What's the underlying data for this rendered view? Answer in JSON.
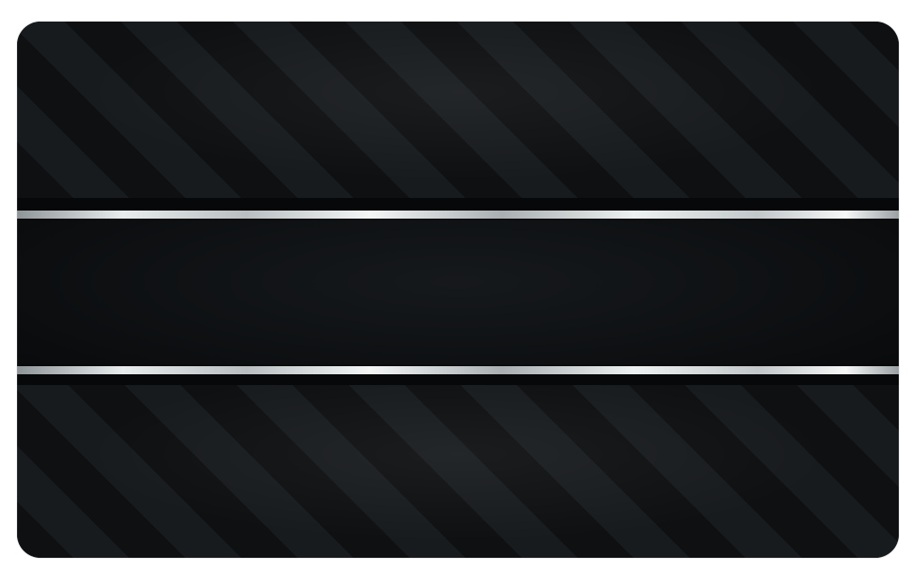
{
  "card": {
    "colors": {
      "base": "#0c0e10",
      "stripe_dark": "#0e1012",
      "stripe_light": "#181b1e",
      "band": "#0b0d0f",
      "silver": "#e8eced",
      "page_background": "#ffffff"
    }
  }
}
